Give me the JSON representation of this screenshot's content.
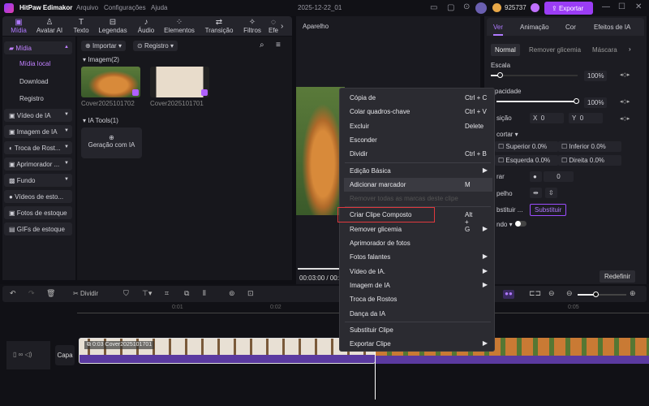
{
  "app": {
    "title": "HitPaw Edimakor",
    "menus": [
      "Arquivo",
      "Configurações",
      "Ajuda"
    ],
    "project": "2025-12-22_01",
    "credits": "925737",
    "export": "Exportar"
  },
  "tabs": [
    {
      "label": "Mídia",
      "icon": "media-icon",
      "active": true
    },
    {
      "label": "Avatar AI",
      "icon": "avatar-icon"
    },
    {
      "label": "Texto",
      "icon": "text-icon"
    },
    {
      "label": "Legendas",
      "icon": "subtitles-icon"
    },
    {
      "label": "Áudio",
      "icon": "audio-icon"
    },
    {
      "label": "Elementos",
      "icon": "elements-icon"
    },
    {
      "label": "Transição",
      "icon": "transition-icon"
    },
    {
      "label": "Filtros",
      "icon": "filters-icon"
    },
    {
      "label": "Efe",
      "icon": "effects-icon"
    }
  ],
  "sidebar": {
    "media": "Mídia",
    "sub": [
      "Mídia local",
      "Download",
      "Registro"
    ],
    "items": [
      "Vídeo de IA",
      "Imagem de IA",
      "Troca de Rost...",
      "Aprimorador ...",
      "Fundo",
      "Vídeos de esto...",
      "Fotos de estoque",
      "GIFs de estoque"
    ]
  },
  "content": {
    "import": "Importar",
    "registro": "Registro",
    "images_header": "Imagem(2)",
    "images": [
      "Cover2025101702",
      "Cover2025101701"
    ],
    "tools_header": "IA Tools(1)",
    "tool": "Geração com IA"
  },
  "preview": {
    "title": "Aparelho",
    "time": "00:03:00 / 00:0"
  },
  "right": {
    "tabs": [
      "Ver",
      "Animação",
      "Cor",
      "Efeitos de IA"
    ],
    "subtabs": [
      "Normal",
      "Remover glicemia",
      "Máscara"
    ],
    "escala": "Escala",
    "escala_val": "100%",
    "escala_level": 0.1,
    "opacidade": "pacidade",
    "opacidade_val": "100%",
    "opacidade_level": 1.0,
    "posicao": "sição",
    "x": "0",
    "y": "0",
    "x_label": "X",
    "y_label": "Y",
    "recortar": "cortar",
    "superior": "Superior",
    "superior_val": "0.0%",
    "inferior": "Inferior",
    "inferior_val": "0.0%",
    "esquerda": "Esquerda",
    "esquerda_val": "0.0%",
    "direita": "Direita",
    "direita_val": "0.0%",
    "girar": "rar",
    "girar_val": "0",
    "espelho": "pelho",
    "substituir_label": "bstituir ...",
    "substituir_btn": "Substituir",
    "fundo": "ndo",
    "redefinir": "Redefinir"
  },
  "context_menu": [
    {
      "label": "Cópia de",
      "shortcut": "Ctrl + C"
    },
    {
      "label": "Colar quadros-chave",
      "shortcut": "Ctrl + V"
    },
    {
      "label": "Excluir",
      "shortcut": "Delete"
    },
    {
      "label": "Esconder"
    },
    {
      "label": "Dividir",
      "shortcut": "Ctrl + B"
    },
    {
      "label": "Edição Básica",
      "submenu": true
    },
    {
      "label": "Adicionar marcador",
      "shortcut": "M",
      "hover": true
    },
    {
      "label": "Remover todas as marcas deste clipe",
      "disabled": true
    },
    {
      "label": "Criar Clipe Composto",
      "shortcut": "Alt + G",
      "highlighted": true
    },
    {
      "label": "Remover glicemia",
      "submenu": true
    },
    {
      "label": "Aprimorador de fotos"
    },
    {
      "label": "Fotos falantes",
      "submenu": true
    },
    {
      "label": "Vídeo de IA.",
      "submenu": true
    },
    {
      "label": "Imagem de IA",
      "submenu": true
    },
    {
      "label": "Troca de Rostos"
    },
    {
      "label": "Dança da IA"
    },
    {
      "label": "Substituir Clipe"
    },
    {
      "label": "Exportar Clipe",
      "submenu": true
    }
  ],
  "timeline": {
    "split": "Dividir",
    "ticks": [
      "0:01",
      "0:02",
      "0:05"
    ],
    "clip_label": "0:03 Cover2025101701",
    "cover": "Capa"
  },
  "colors": {
    "accent": "#9b4dff",
    "highlight_box": "#e0393e",
    "clip": "#5b3aa0"
  }
}
